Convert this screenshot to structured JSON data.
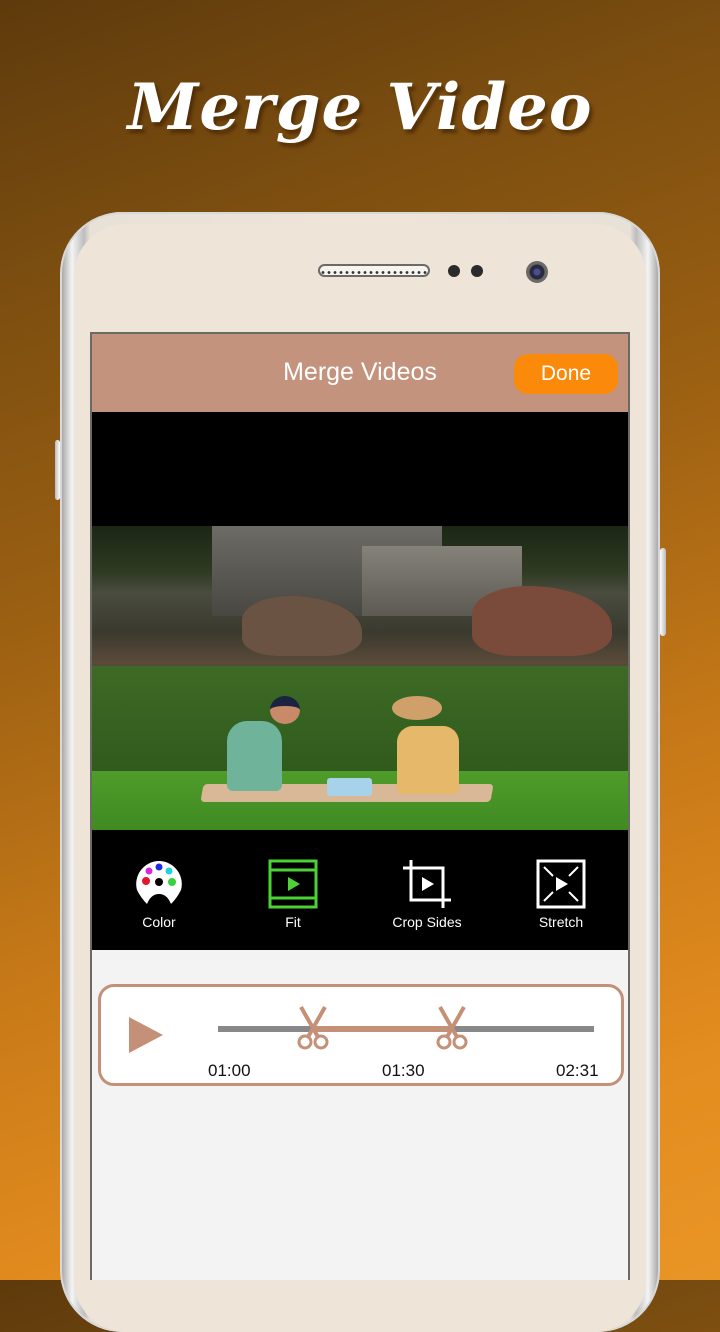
{
  "promo": {
    "title": "Merge Video"
  },
  "app_bar": {
    "title": "Merge Videos",
    "done_label": "Done"
  },
  "tools": [
    {
      "label": "Color",
      "icon": "palette-icon"
    },
    {
      "label": "Fit",
      "icon": "fit-icon",
      "selected": true
    },
    {
      "label": "Crop Sides",
      "icon": "crop-icon"
    },
    {
      "label": "Stretch",
      "icon": "stretch-icon"
    }
  ],
  "timeline": {
    "start_time": "01:00",
    "mid_time": "01:30",
    "end_time": "02:31"
  },
  "colors": {
    "app_bar": "#c3937d",
    "done_button": "#fb8a0a",
    "fit_selected": "#4cd137",
    "timeline_accent": "#c49078"
  }
}
